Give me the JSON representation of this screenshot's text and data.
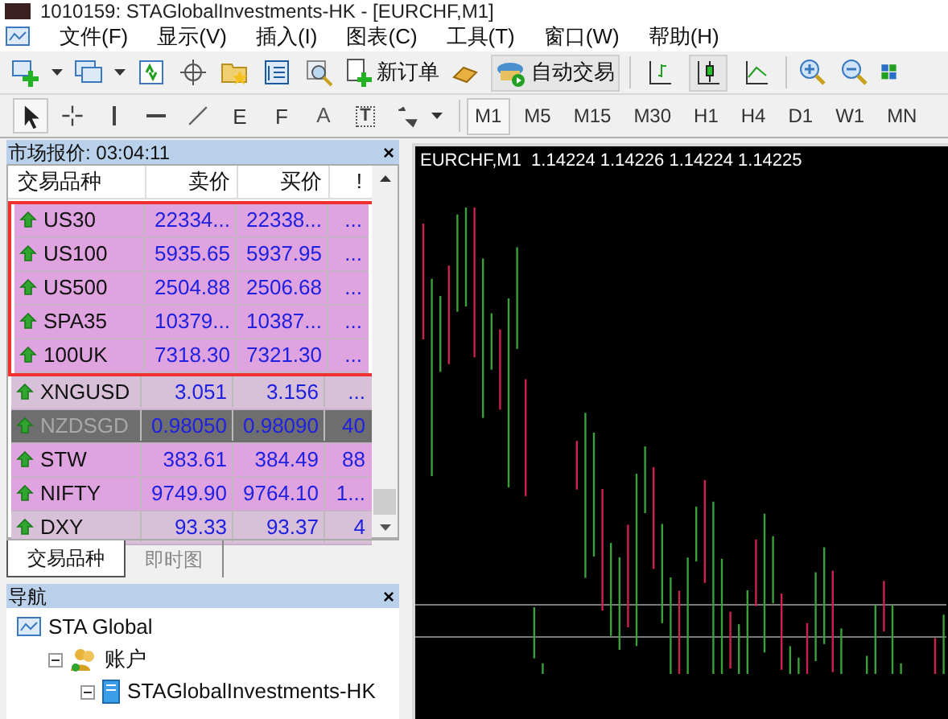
{
  "window": {
    "title": "1010159: STAGlobalInvestments-HK - [EURCHF,M1]"
  },
  "menu": [
    "文件(F)",
    "显示(V)",
    "插入(I)",
    "图表(C)",
    "工具(T)",
    "窗口(W)",
    "帮助(H)"
  ],
  "toolbar": {
    "new_order": "新订单",
    "auto_trading": "自动交易",
    "chart_types": [
      {
        "kind": "bar",
        "selected": false
      },
      {
        "kind": "candle",
        "selected": true
      },
      {
        "kind": "line",
        "selected": false
      }
    ]
  },
  "tools": [
    {
      "kind": "cursor",
      "selected": true
    },
    {
      "kind": "crosshair",
      "selected": false
    },
    {
      "kind": "vline",
      "selected": false
    },
    {
      "kind": "hline",
      "selected": false
    },
    {
      "kind": "trend",
      "selected": false
    },
    {
      "kind": "channel",
      "label": "E",
      "selected": false
    },
    {
      "kind": "fibo",
      "label": "F",
      "selected": false
    },
    {
      "kind": "text",
      "label": "A",
      "selected": false
    },
    {
      "kind": "label",
      "label": "T",
      "selected": false
    },
    {
      "kind": "arrows",
      "selected": false
    }
  ],
  "timeframes": [
    {
      "label": "M1",
      "selected": true
    },
    {
      "label": "M5",
      "selected": false
    },
    {
      "label": "M15",
      "selected": false
    },
    {
      "label": "M30",
      "selected": false
    },
    {
      "label": "H1",
      "selected": false
    },
    {
      "label": "H4",
      "selected": false
    },
    {
      "label": "D1",
      "selected": false
    },
    {
      "label": "W1",
      "selected": false
    },
    {
      "label": "MN",
      "selected": false
    }
  ],
  "market_watch": {
    "title": "市场报价: 03:04:11",
    "close": "×",
    "columns": [
      "交易品种",
      "卖价",
      "买价",
      "!"
    ],
    "rows": [
      {
        "symbol": "US30",
        "bid": "22334...",
        "ask": "22338...",
        "spread": "...",
        "color": "#dfa3df",
        "disabled": false,
        "highlighted": true
      },
      {
        "symbol": "US100",
        "bid": "5935.65",
        "ask": "5937.95",
        "spread": "...",
        "color": "#dfa3df",
        "disabled": false,
        "highlighted": true
      },
      {
        "symbol": "US500",
        "bid": "2504.88",
        "ask": "2506.68",
        "spread": "...",
        "color": "#dfa3df",
        "disabled": false,
        "highlighted": true
      },
      {
        "symbol": "SPA35",
        "bid": "10379...",
        "ask": "10387...",
        "spread": "...",
        "color": "#dfa3df",
        "disabled": false,
        "highlighted": true
      },
      {
        "symbol": "100UK",
        "bid": "7318.30",
        "ask": "7321.30",
        "spread": "...",
        "color": "#dfa3df",
        "disabled": false,
        "highlighted": true
      },
      {
        "symbol": "XNGUSD",
        "bid": "3.051",
        "ask": "3.156",
        "spread": "...",
        "color": "#d8c0d8",
        "disabled": false,
        "highlighted": false
      },
      {
        "symbol": "NZDSGD",
        "bid": "0.98050",
        "ask": "0.98090",
        "spread": "40",
        "color": "#6e6e6e",
        "disabled": true,
        "highlighted": false
      },
      {
        "symbol": "STW",
        "bid": "383.61",
        "ask": "384.49",
        "spread": "88",
        "color": "#dfa3df",
        "disabled": false,
        "highlighted": false
      },
      {
        "symbol": "NIFTY",
        "bid": "9749.90",
        "ask": "9764.10",
        "spread": "1...",
        "color": "#dfa3df",
        "disabled": false,
        "highlighted": false
      },
      {
        "symbol": "DXY",
        "bid": "93.33",
        "ask": "93.37",
        "spread": "4",
        "color": "#d8c0d8",
        "disabled": false,
        "highlighted": false
      }
    ],
    "tabs": [
      {
        "label": "交易品种",
        "selected": true
      },
      {
        "label": "即时图",
        "selected": false
      }
    ]
  },
  "navigator": {
    "title": "导航",
    "close": "×",
    "tree": [
      {
        "label": "STA Global",
        "kind": "root",
        "children": [
          {
            "label": "账户",
            "kind": "accounts",
            "expanded": true,
            "children": [
              {
                "label": "STAGlobalInvestments-HK",
                "kind": "server",
                "expanded": true
              }
            ]
          }
        ]
      }
    ]
  },
  "chart": {
    "header": "EURCHF,M1  1.14224 1.14226 1.14224 1.14225"
  }
}
